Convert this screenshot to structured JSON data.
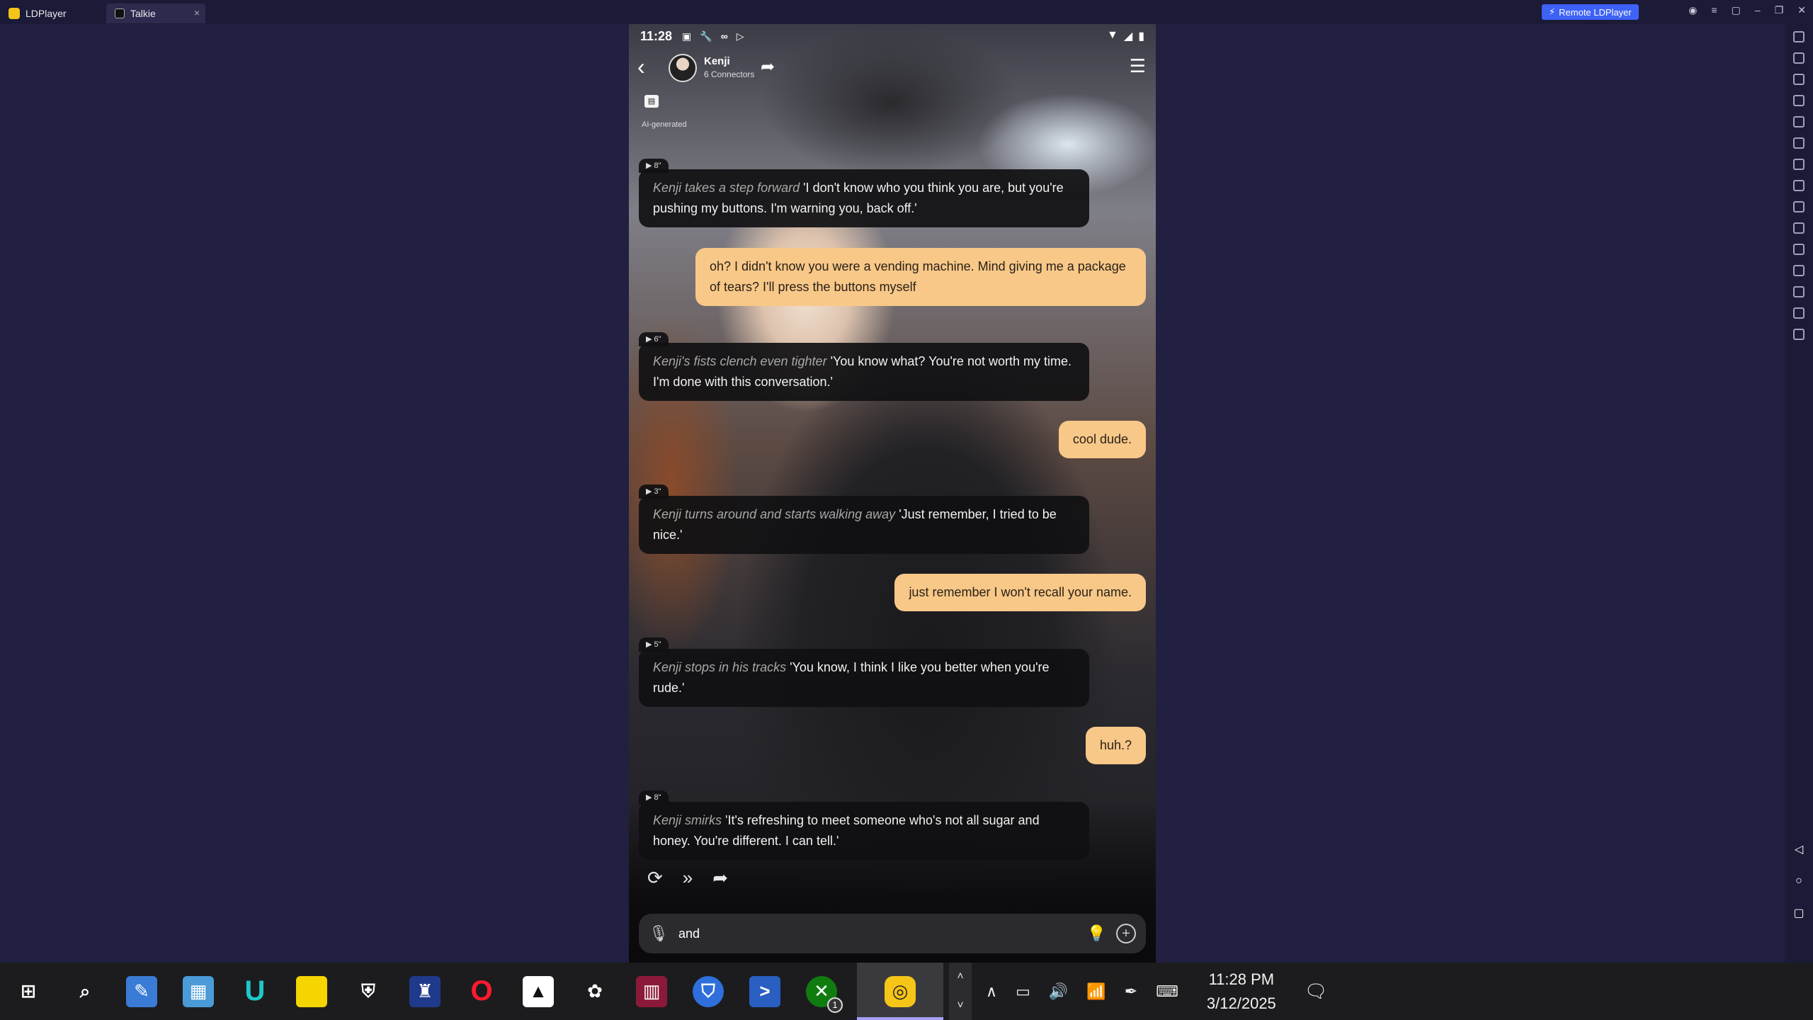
{
  "titlebar": {
    "tabs": [
      {
        "label": "LDPlayer"
      },
      {
        "label": "Talkie"
      }
    ],
    "remote_button": "Remote LDPlayer",
    "close_glyph": "×"
  },
  "phone": {
    "status": {
      "time": "11:28"
    },
    "header": {
      "character_name": "Kenji",
      "subtitle": "6 Connectors",
      "ai_label": "AI-generated"
    },
    "messages": [
      {
        "role": "ai",
        "duration": "▶ 8\"",
        "action": "Kenji takes a step forward",
        "text": "'I don't know who you think you are, but you're pushing my buttons. I'm warning you, back off.'"
      },
      {
        "role": "user",
        "text": "oh? I didn't know you were a vending machine. Mind giving me a package of tears? I'll press the buttons myself"
      },
      {
        "role": "ai",
        "duration": "▶ 6\"",
        "action": "Kenji's fists clench even tighter",
        "text": "'You know what? You're not worth my time. I'm done with this conversation.'"
      },
      {
        "role": "user",
        "text": "cool dude."
      },
      {
        "role": "ai",
        "duration": "▶ 3\"",
        "action": "Kenji turns around and starts walking away",
        "text": "'Just remember, I tried to be nice.'"
      },
      {
        "role": "user",
        "text": "just remember I won't recall your name."
      },
      {
        "role": "ai",
        "duration": "▶ 5\"",
        "action": "Kenji stops in his tracks",
        "text": "'You know, I think I like you better when you're rude.'"
      },
      {
        "role": "user",
        "text": "huh.?"
      },
      {
        "role": "ai",
        "duration": "▶ 8\"",
        "action": "Kenji smirks",
        "text": "'It's refreshing to meet someone who's not all sugar and honey. You're different. I can tell.'"
      }
    ],
    "input": {
      "value": "and "
    }
  },
  "taskbar": {
    "apps": [
      "start-icon",
      "search-icon",
      "paint-icon",
      "control-panel-icon",
      "u-app-icon",
      "sticky-notes-icon",
      "defender-icon",
      "game-app-icon",
      "opera-icon",
      "app-a-icon",
      "picsart-icon",
      "winrar-icon",
      "bitwarden-icon",
      "powershell-icon",
      "xbox-icon",
      "ldplayer-icon"
    ],
    "xbox_badge": "1",
    "clock_time": "11:28 PM",
    "clock_date": "3/12/2025"
  },
  "colors": {
    "user_bubble": "#f8c888",
    "ai_bubble": "#101012",
    "accent": "#3d62f5"
  }
}
